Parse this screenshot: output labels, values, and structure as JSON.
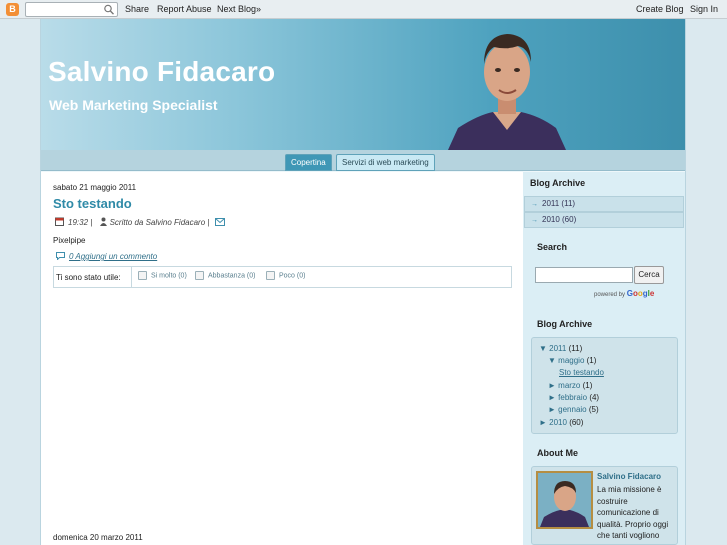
{
  "navbar": {
    "logo": "B",
    "share": "Share",
    "report_abuse": "Report Abuse",
    "next_blog": "Next Blog»",
    "create_blog": "Create Blog",
    "sign_in": "Sign In"
  },
  "header": {
    "title": "Salvino Fidacaro",
    "description": "Web Marketing Specialist"
  },
  "tabs": [
    {
      "label": "Copertina",
      "active": true
    },
    {
      "label": "Servizi di web marketing",
      "active": false
    }
  ],
  "main": {
    "post1": {
      "date": "sabato 21 maggio 2011",
      "title": "Sto testando",
      "time": "19:32 |",
      "author": "Scritto da Salvino Fidacaro |",
      "body": "Pixelpipe",
      "comment_link": "0 Aggiungi un commento",
      "reactions_label": "Ti sono stato utile:",
      "reactions": [
        "Si molto (0)",
        "Abbastanza (0)",
        "Poco (0)"
      ]
    },
    "post2": {
      "date": "domenica 20 marzo 2011"
    }
  },
  "sidebar": {
    "archive_top_title": "Blog Archive",
    "archive_top": [
      "2011 (11)",
      "2010 (60)"
    ],
    "search_title": "Search",
    "search_button": "Cerca",
    "powered_by": "powered by",
    "google": "Google",
    "archive_title": "Blog Archive",
    "tree": {
      "y2011": "2011",
      "y2011_count": "(11)",
      "maggio": "maggio",
      "maggio_count": "(1)",
      "post": "Sto testando",
      "marzo": "marzo",
      "marzo_count": "(1)",
      "febbraio": "febbraio",
      "febbraio_count": "(4)",
      "gennaio": "gennaio",
      "gennaio_count": "(5)",
      "y2010": "2010",
      "y2010_count": "(60)"
    },
    "about_title": "About Me",
    "about_name": "Salvino Fidacaro",
    "about_text": "La mia missione è costruire comunicazione di qualità. Proprio oggi che tanti vogliono"
  },
  "colors": {
    "accent": "#2f8aa7",
    "tab_active": "#3f97b6",
    "header_dark": "#3d8fac"
  }
}
